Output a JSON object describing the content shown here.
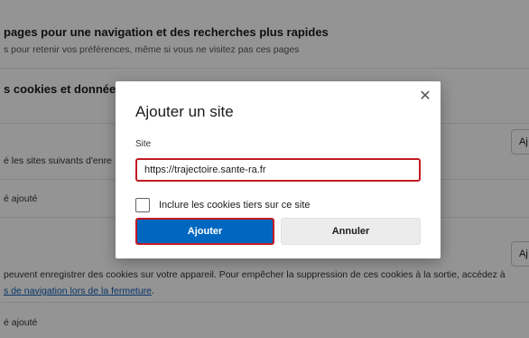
{
  "background": {
    "section1_title": "pages pour une navigation et des recherches plus rapides",
    "section1_sub": "s pour retenir vos préférences, même si vous ne visitez pas ces pages",
    "section2_title": "s cookies et données c",
    "allow_desc": "é les sites suivants d'enre",
    "allow_empty": "é ajouté",
    "clear_desc": "peuvent enregistrer des cookies sur votre appareil. Pour empêcher la suppression de ces cookies à la sortie, accédez à",
    "clear_link": "s de navigation lors de la fermeture",
    "clear_link_suffix": ".",
    "clear_empty": "é ajouté",
    "add_button_1": "Aj",
    "add_button_2": "Aj"
  },
  "dialog": {
    "title": "Ajouter un site",
    "close_glyph": "✕",
    "site_label": "Site",
    "site_value": "https://trajectoire.sante-ra.fr",
    "checkbox_label": "Inclure les cookies tiers sur ce site",
    "checkbox_checked": false,
    "primary_label": "Ajouter",
    "secondary_label": "Annuler"
  },
  "colors": {
    "primary": "#0067c0",
    "highlight": "#c11b22",
    "link": "#0e5bb5"
  }
}
